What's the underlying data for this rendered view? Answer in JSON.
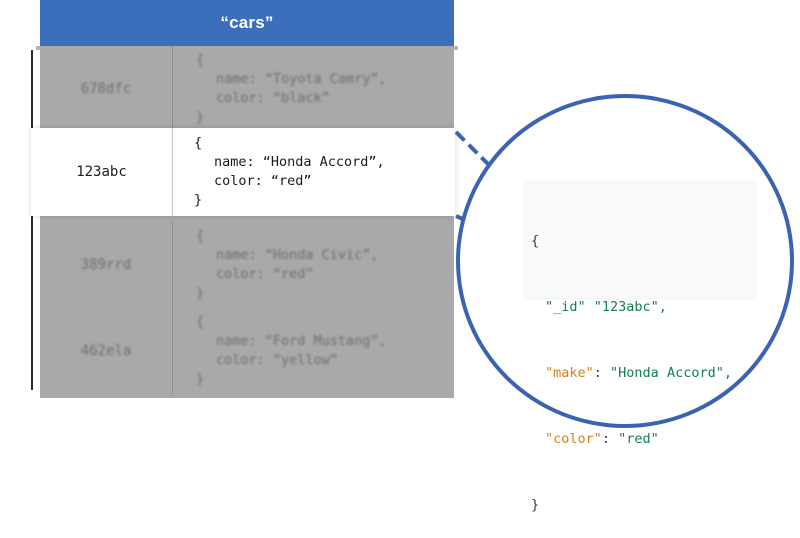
{
  "collection": {
    "title": "“cars”"
  },
  "documents": [
    {
      "id": "678dfc",
      "open": "{",
      "name_line": "name: “Toyota Camry”,",
      "color_line": "color: “black”",
      "close": "}"
    },
    {
      "id": "123abc",
      "open": "{",
      "name_line": "name: “Honda Accord”,",
      "color_line": "color: “red”",
      "close": "}"
    },
    {
      "id": "389rrd",
      "open": "{",
      "name_line": "name: “Honda Civic”,",
      "color_line": "color: “red”",
      "close": "}"
    },
    {
      "id": "462ela",
      "open": "{",
      "name_line": "name: “Ford Mustang”,",
      "color_line": "color: “yellow”",
      "close": "}"
    }
  ],
  "detail": {
    "open": "{",
    "id_key": "\"_id\"",
    "id_value": "\"123abc\",",
    "make_key": "\"make\"",
    "make_value": "\"Honda Accord\",",
    "color_key": "\"color\"",
    "color_value": "\"red\"",
    "sep": ": ",
    "space": " ",
    "close": "}"
  },
  "colors": {
    "header": "#3b6fbc",
    "lens_border": "#3c63b0",
    "key": "#d37f1e",
    "value": "#127f4e"
  }
}
